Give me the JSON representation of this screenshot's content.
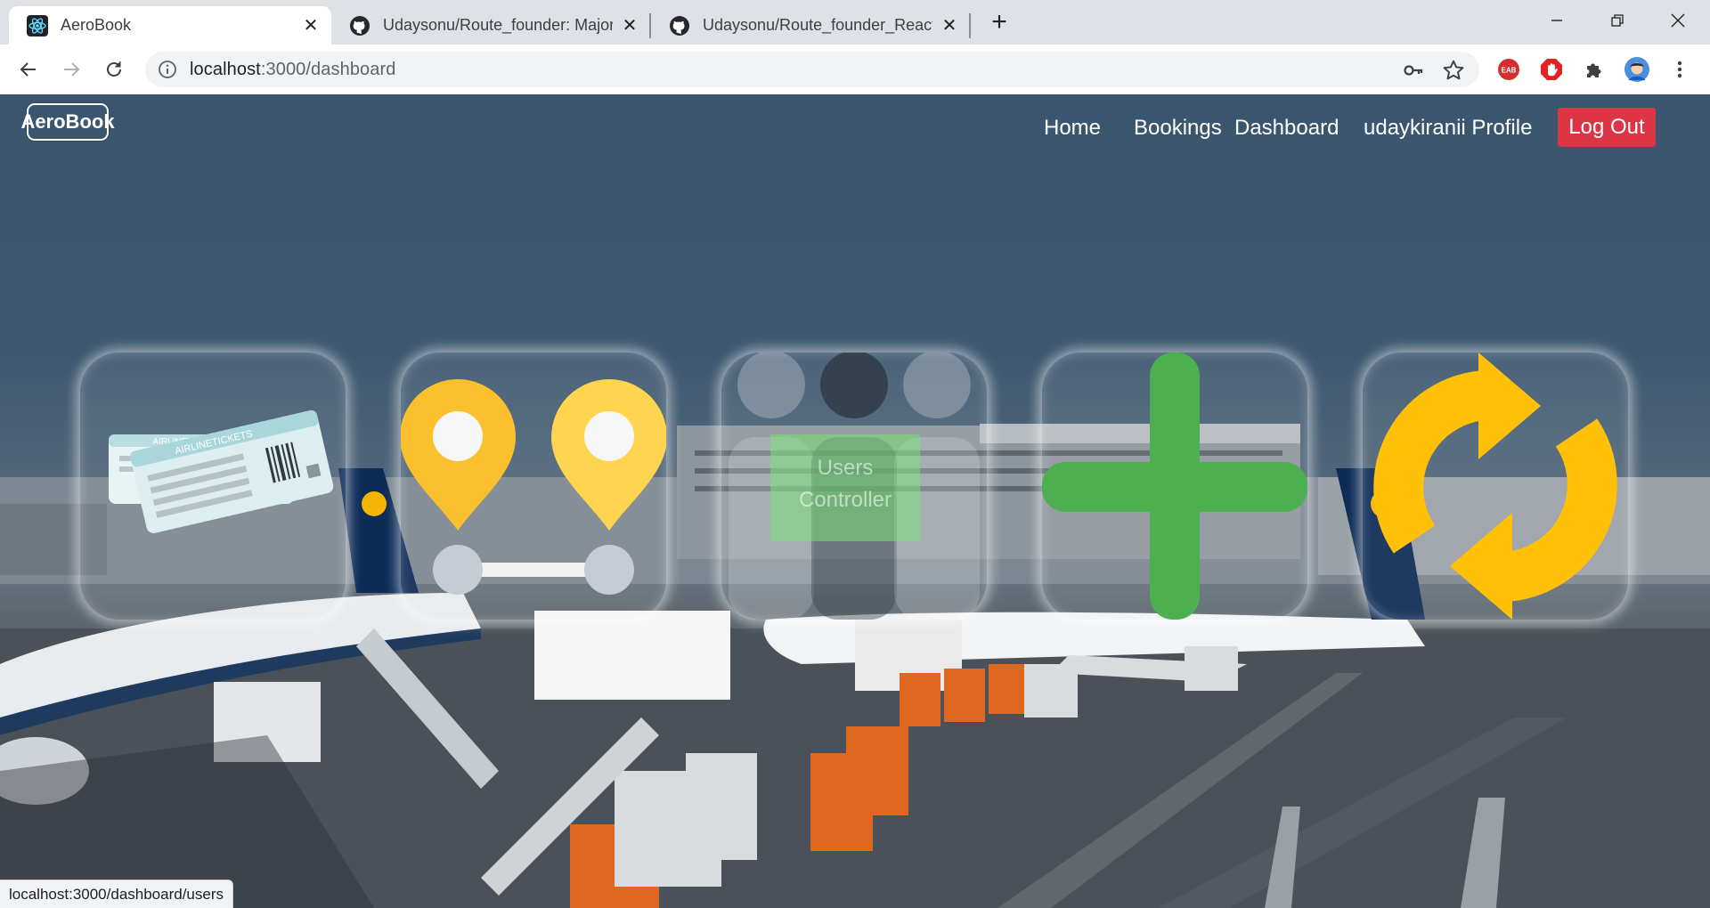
{
  "browser": {
    "tabs": [
      {
        "title": "AeroBook",
        "active": true
      },
      {
        "title": "Udaysonu/Route_founder: Major",
        "active": false
      },
      {
        "title": "Udaysonu/Route_founder_React_",
        "active": false
      }
    ],
    "url_host": "localhost",
    "url_path": ":3000/dashboard",
    "status_text": "localhost:3000/dashboard/users"
  },
  "navbar": {
    "brand": "AeroBook",
    "links": [
      "Home",
      "Bookings",
      "Dashboard",
      "udaykiranii Profile"
    ],
    "logout_label": "Log Out"
  },
  "dashboard": {
    "cards": [
      {
        "icon": "airline-tickets-icon",
        "ticket_text": "AIRLINETICKETS"
      },
      {
        "icon": "route-pins-icon"
      },
      {
        "icon": "users-controller-icon",
        "label_line1": "Users",
        "label_line2": "Controller"
      },
      {
        "icon": "plus-icon"
      },
      {
        "icon": "refresh-icon"
      }
    ]
  },
  "colors": {
    "logout": "#dc3545",
    "pin_yellow": "#fbc02d",
    "plus_green": "#4caf50",
    "refresh_yellow": "#ffc107"
  }
}
